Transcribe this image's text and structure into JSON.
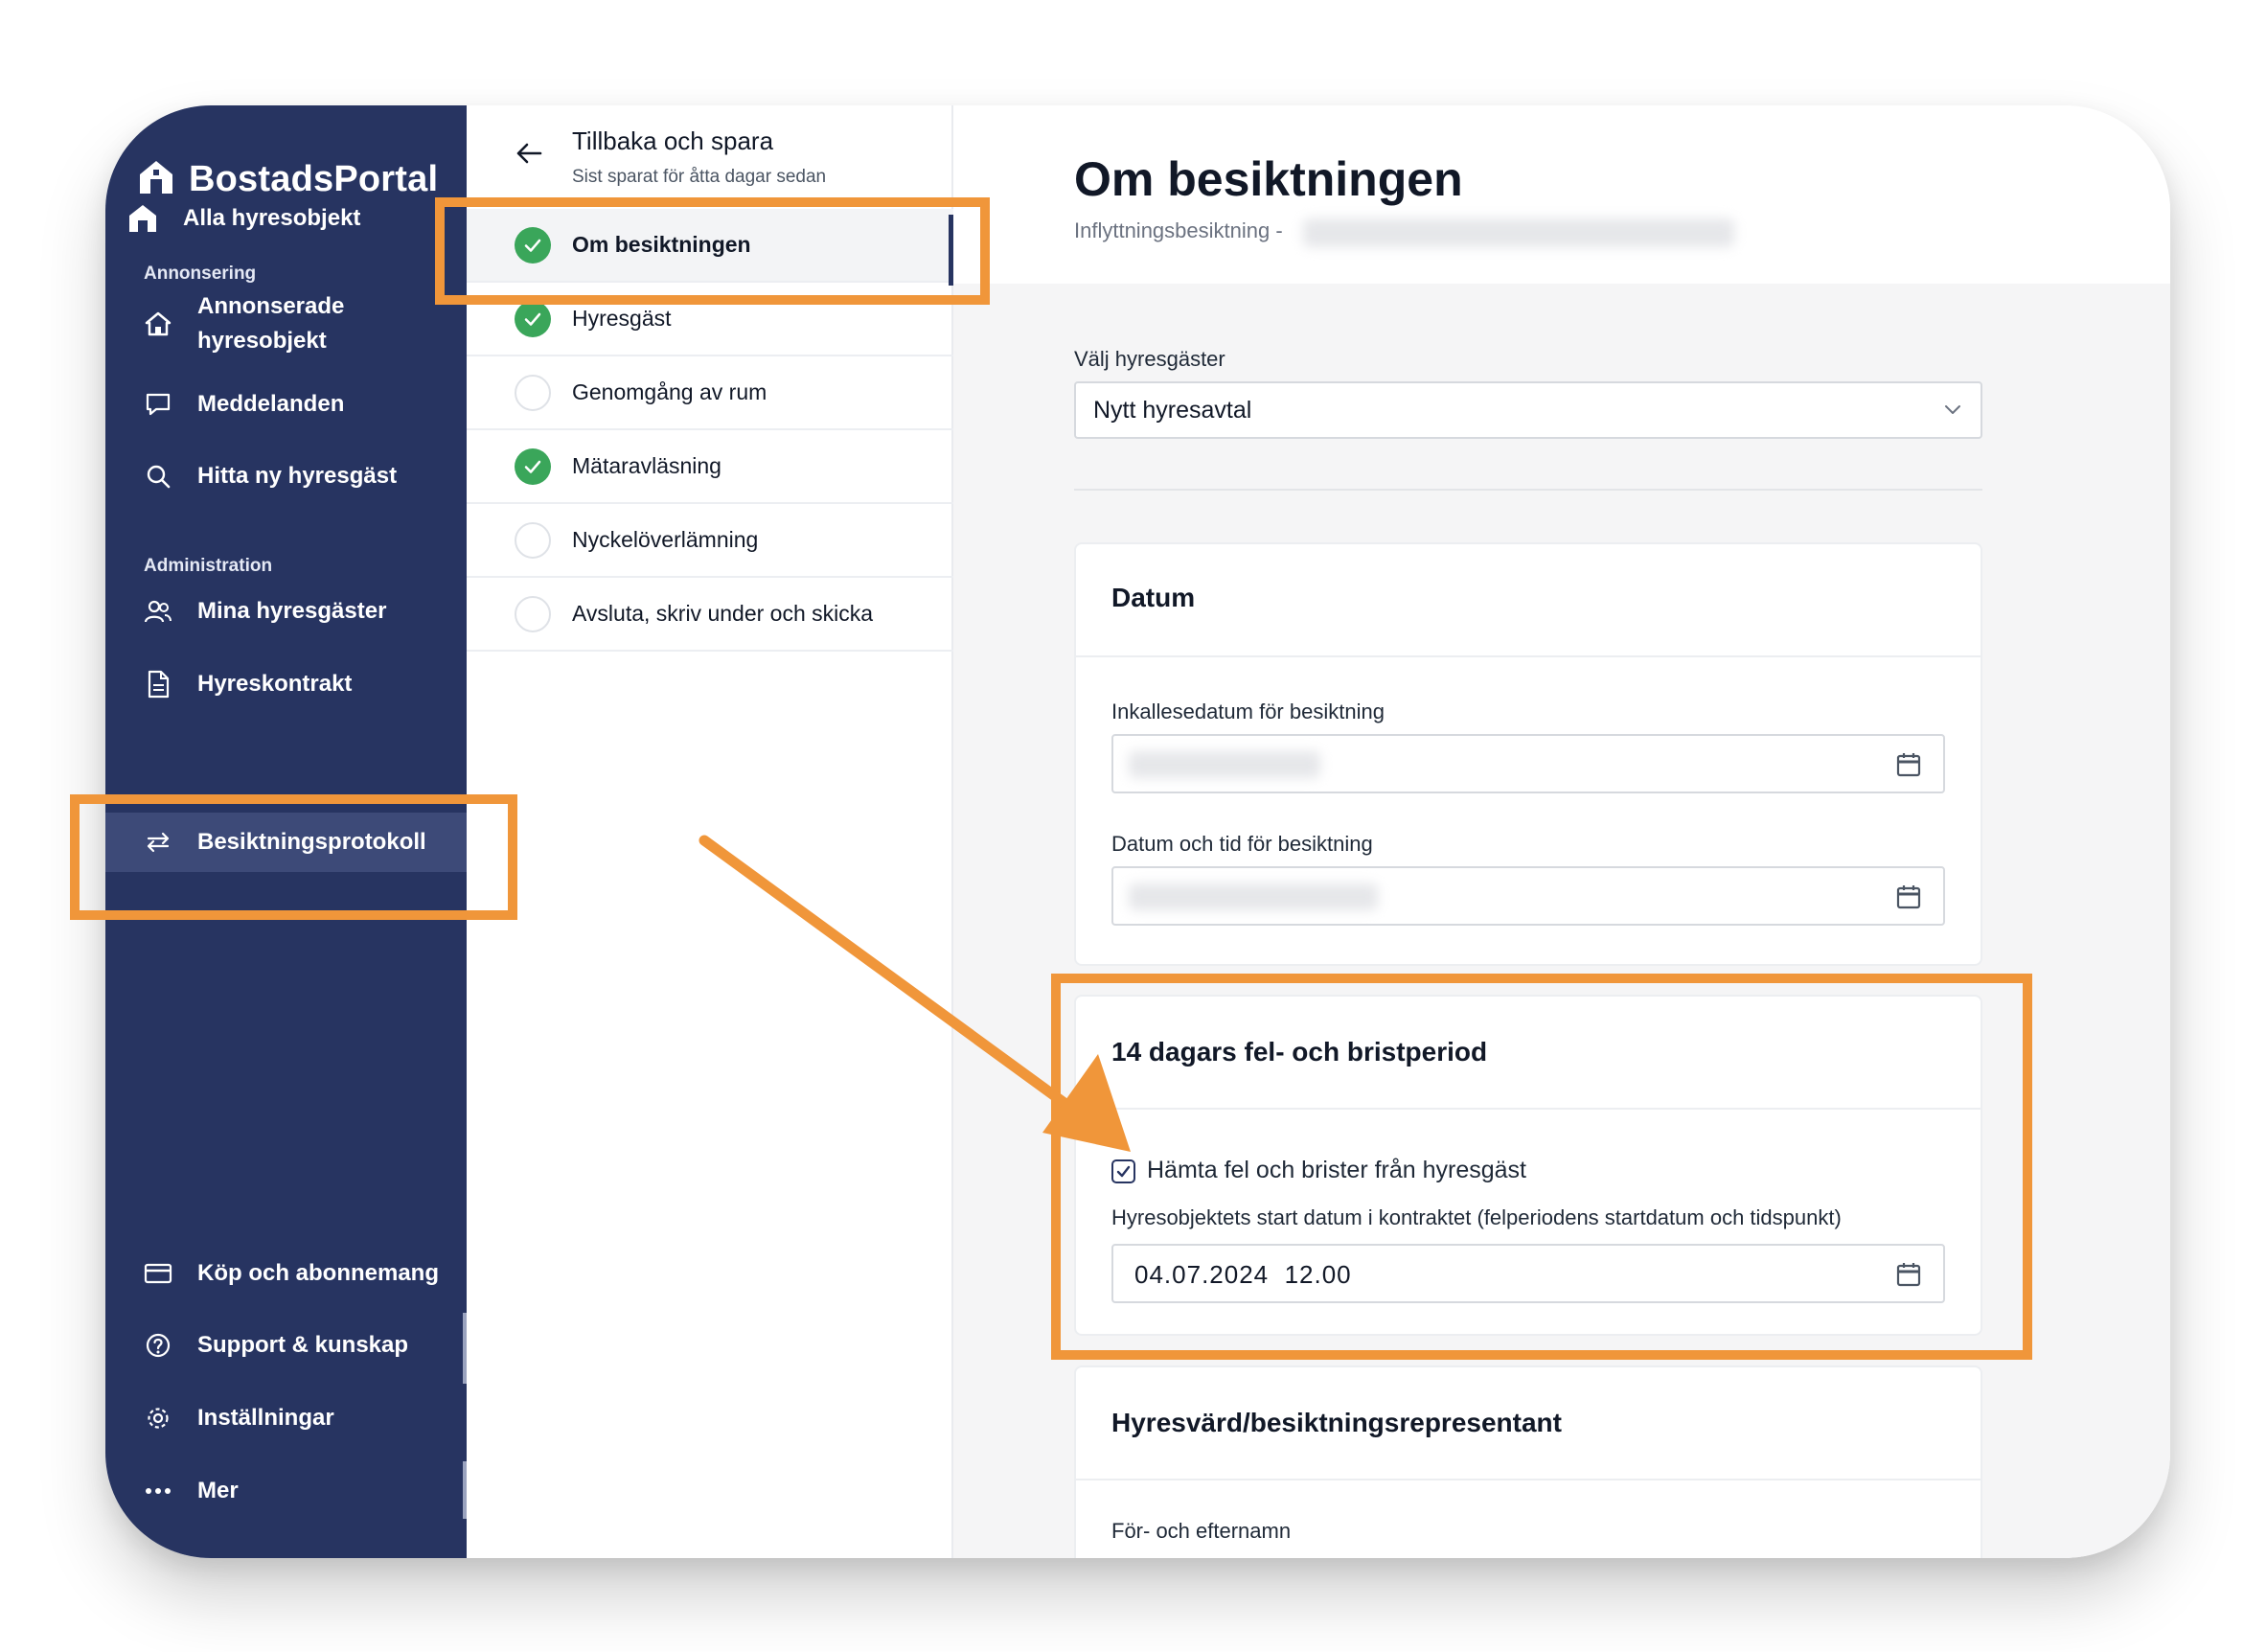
{
  "brand": {
    "name": "BostadsPortal"
  },
  "sidebar": {
    "top_item": {
      "label": "Alla hyresobjekt",
      "icon": "home-icon"
    },
    "sections": [
      {
        "label": "Annonsering"
      },
      {
        "label": "Administration"
      }
    ],
    "items": [
      {
        "label": "Annonserade hyresobjekt",
        "line1": "Annonserade",
        "line2": "hyresobjekt",
        "icon": "house-icon"
      },
      {
        "label": "Meddelanden",
        "icon": "chat-icon"
      },
      {
        "label": "Hitta ny hyresgäst",
        "icon": "search-icon"
      },
      {
        "label": "Mina hyresgäster",
        "icon": "users-icon"
      },
      {
        "label": "Hyreskontrakt",
        "icon": "document-icon"
      },
      {
        "label": "Besiktningsprotokoll",
        "icon": "swap-arrows-icon",
        "active": true
      }
    ],
    "bottom_items": [
      {
        "label": "Köp och abonnemang",
        "icon": "credit-card-icon"
      },
      {
        "label": "Support & kunskap",
        "icon": "help-circle-icon"
      },
      {
        "label": "Inställningar",
        "icon": "gear-icon"
      },
      {
        "label": "Mer",
        "icon": "more-dots-icon"
      }
    ]
  },
  "steps_panel": {
    "back_label": "Tillbaka och spara",
    "saved_note": "Sist sparat för åtta dagar sedan",
    "steps": [
      {
        "label": "Om besiktningen",
        "status": "done",
        "active": true
      },
      {
        "label": "Hyresgäst",
        "status": "done"
      },
      {
        "label": "Genomgång av rum",
        "status": "todo"
      },
      {
        "label": "Mätaravläsning",
        "status": "done"
      },
      {
        "label": "Nyckelöverlämning",
        "status": "todo"
      },
      {
        "label": "Avsluta, skriv under och skicka",
        "status": "todo"
      }
    ]
  },
  "main": {
    "title": "Om besiktningen",
    "subtitle": "Inflyttningsbesiktning -",
    "tenant_select": {
      "label": "Välj hyresgäster",
      "value": "Nytt hyresavtal"
    },
    "date_card": {
      "title": "Datum",
      "summons_label": "Inkallesedatum för besiktning",
      "datetime_label": "Datum och tid för besiktning"
    },
    "defect_card": {
      "title": "14 dagars fel- och bristperiod",
      "checkbox_label": "Hämta fel och brister från hyresgäst",
      "checkbox_checked": true,
      "start_label": "Hyresobjektets start datum i kontraktet (felperiodens startdatum och tidspunkt)",
      "start_value": "04.07.2024  12.00"
    },
    "landlord_card": {
      "title": "Hyresvärd/besiktningsrepresentant",
      "name_label": "För- och efternamn"
    }
  },
  "colors": {
    "sidebar": "#273461",
    "accent_highlight": "#f0963a",
    "done": "#3aa65a"
  }
}
